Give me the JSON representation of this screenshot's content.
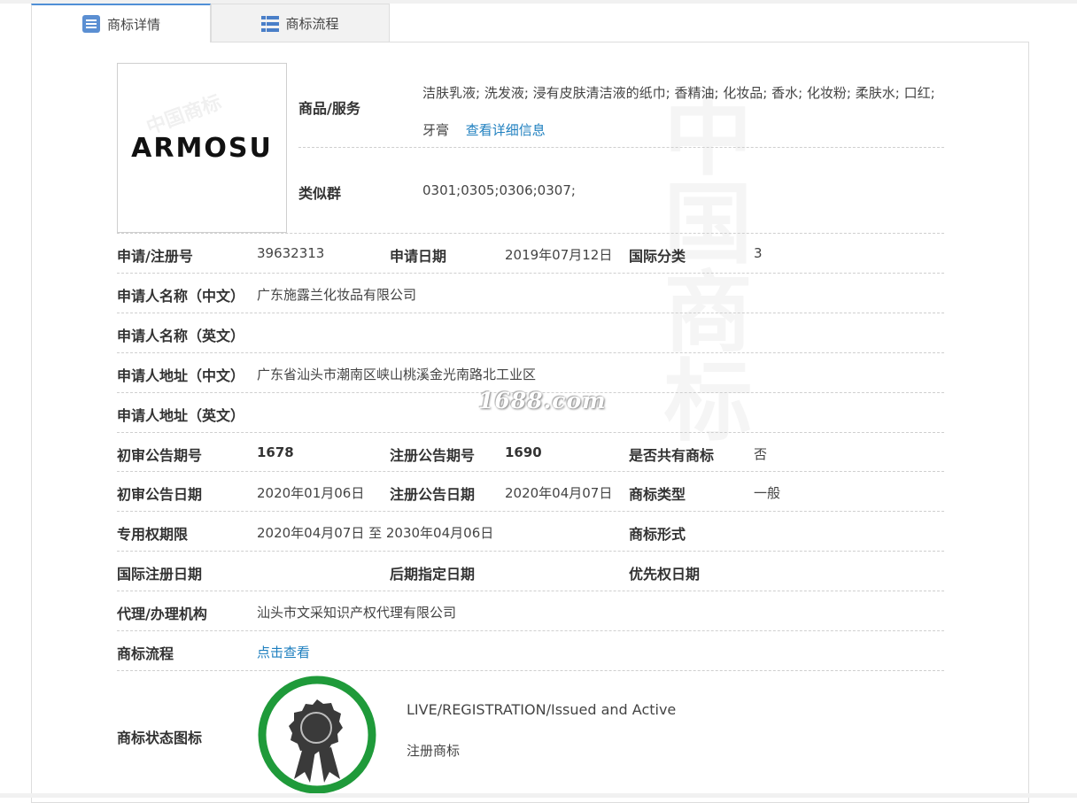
{
  "tabs": {
    "detail_label": "商标详情",
    "flow_label": "商标流程"
  },
  "logo": {
    "text": "ARMOSU",
    "watermark": "中国商标"
  },
  "goods": {
    "label": "商品/服务",
    "value": "洁肤乳液; 洗发液; 浸有皮肤清洁液的纸巾; 香精油; 化妆品; 香水; 化妆粉; 柔肤水; 口红; 牙膏",
    "detail_link": "查看详细信息"
  },
  "similar_group": {
    "label": "类似群",
    "value": "0301;0305;0306;0307;"
  },
  "rows": {
    "app_no_label": "申请/注册号",
    "app_no_value": "39632313",
    "app_date_label": "申请日期",
    "app_date_value": "2019年07月12日",
    "intl_class_label": "国际分类",
    "intl_class_value": "3",
    "applicant_cn_label": "申请人名称（中文）",
    "applicant_cn_value": "广东施露兰化妆品有限公司",
    "applicant_en_label": "申请人名称（英文）",
    "address_cn_label": "申请人地址（中文）",
    "address_cn_value": "广东省汕头市潮南区峡山桃溪金光南路北工业区",
    "address_en_label": "申请人地址（英文）",
    "prelim_no_label": "初审公告期号",
    "prelim_no_value": "1678",
    "reg_no_label": "注册公告期号",
    "reg_no_value": "1690",
    "shared_label": "是否共有商标",
    "shared_value": "否",
    "prelim_date_label": "初审公告日期",
    "prelim_date_value": "2020年01月06日",
    "reg_date_label": "注册公告日期",
    "reg_date_value": "2020年04月07日",
    "type_label": "商标类型",
    "type_value": "一般",
    "term_label": "专用权期限",
    "term_value": "2020年04月07日 至 2030年04月06日",
    "form_label": "商标形式",
    "intl_reg_date_label": "国际注册日期",
    "later_date_label": "后期指定日期",
    "priority_date_label": "优先权日期",
    "agent_label": "代理/办理机构",
    "agent_value": "汕头市文采知识产权代理有限公司",
    "flow_label": "商标流程",
    "flow_link": "点击查看",
    "status_icon_label": "商标状态图标",
    "status_en": "LIVE/REGISTRATION/Issued and Active",
    "status_cn": "注册商标"
  },
  "watermark_site": "1688.com",
  "background_watermark": "中国商标",
  "colors": {
    "link": "#1e7fbf",
    "tab_accent": "#4f8fd6",
    "badge_ring": "#1f9a3a",
    "badge_seal": "#3a3a3a"
  },
  "icons": {
    "detail_tab": "list-document-icon",
    "flow_tab": "list-table-icon",
    "status": "award-seal-icon"
  }
}
